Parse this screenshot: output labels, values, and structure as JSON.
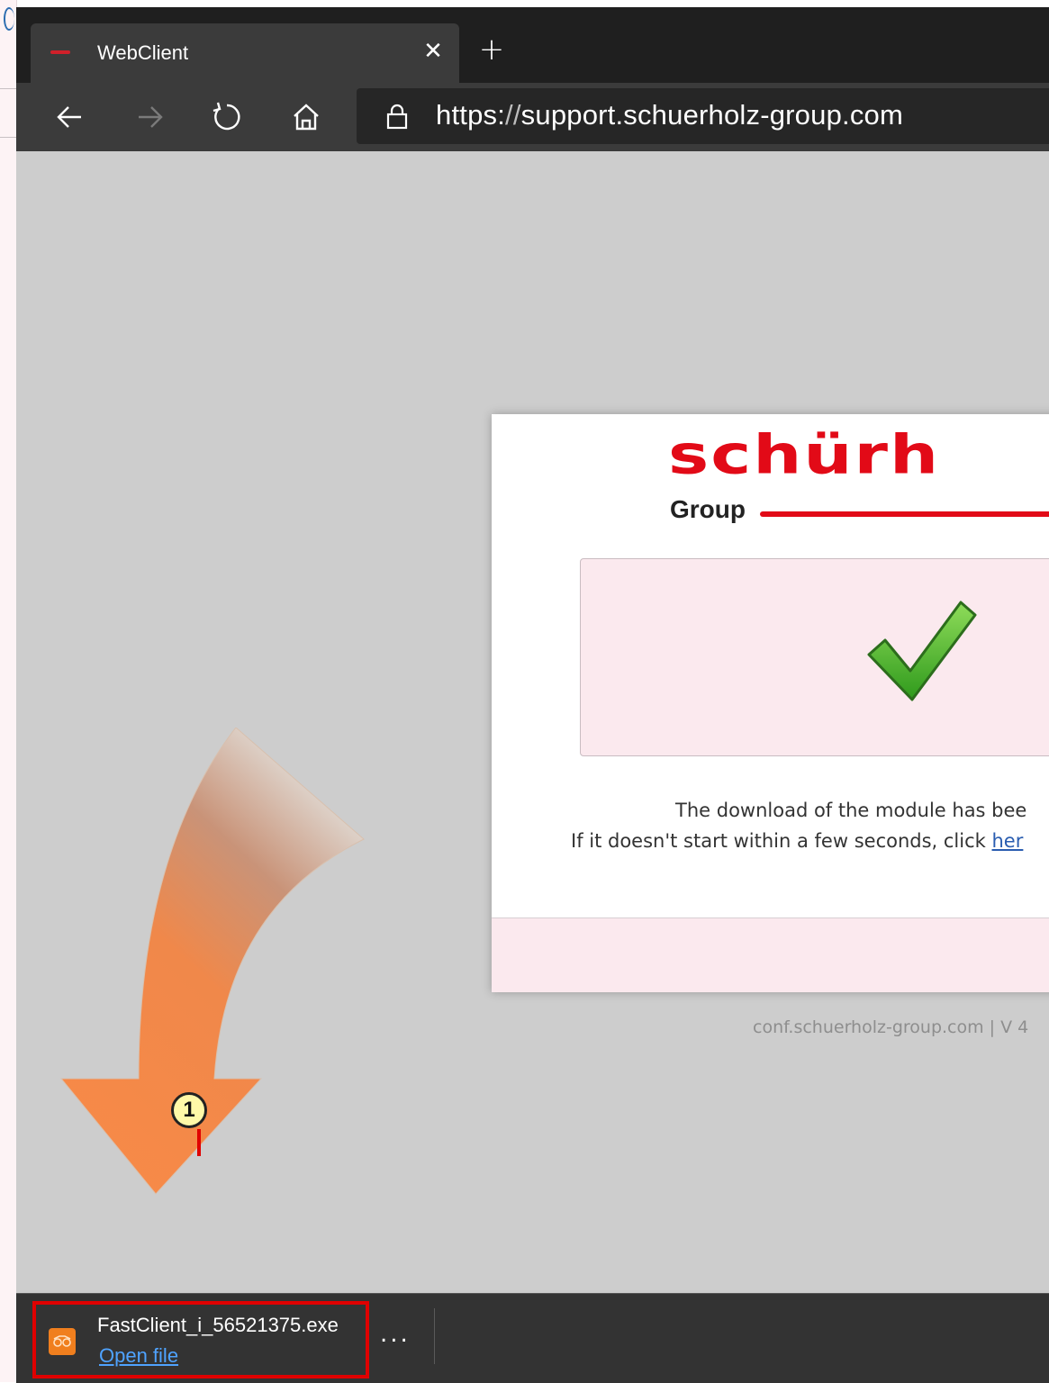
{
  "tab": {
    "title": "WebClient",
    "favicon": "schuerholz-favicon",
    "close_icon": "close-icon"
  },
  "new_tab_icon": "plus-icon",
  "toolbar": {
    "back_icon": "arrow-left-icon",
    "forward_icon": "arrow-right-icon",
    "refresh_icon": "refresh-icon",
    "home_icon": "home-icon",
    "lock_icon": "lock-icon",
    "url_scheme": "https:",
    "url_slashes": "//",
    "url_host": "support.schuerholz-group.com"
  },
  "logo": {
    "word": "schürh",
    "group": "Group",
    "brand_color": "#e20a17"
  },
  "card": {
    "check_icon": "checkmark-icon",
    "message_line1": "The download of the module has bee",
    "message_line2_prefix": "If it doesn't start within a few seconds, click ",
    "message_link": "her"
  },
  "footer_note": "conf.schuerholz-group.com | V 4",
  "annotation": {
    "number": "1",
    "color": "#e00000"
  },
  "download": {
    "filename": "FastClient_i_56521375.exe",
    "open_label": "Open file",
    "more_label": "...",
    "icon": "fastclient-icon"
  }
}
